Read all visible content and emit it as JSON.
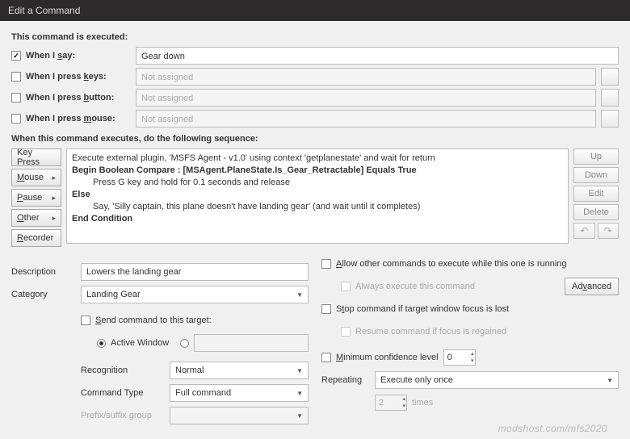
{
  "window": {
    "title": "Edit a Command"
  },
  "section1_head": "This command is executed:",
  "triggers": {
    "say_label": "When I say:",
    "say_value": "Gear down",
    "keys_label": "When I press keys:",
    "keys_value": "Not assigned",
    "button_label": "When I press button:",
    "button_value": "Not assigned",
    "mouse_label": "When I press mouse:",
    "mouse_value": "Not assigned"
  },
  "section2_head": "When this command executes, do the following sequence:",
  "side_buttons": {
    "keypress": "Key Press",
    "mouse": "Mouse",
    "pause": "Pause",
    "other": "Other",
    "recorder": "Recorder"
  },
  "script": {
    "l1": "Execute external plugin, 'MSFS Agent - v1.0' using context 'getplanestate' and wait for return",
    "l2": "Begin Boolean Compare : [MSAgent.PlaneState.Is_Gear_Retractable] Equals True",
    "l3": "Press G key and hold for 0.1 seconds and release",
    "l4": "Else",
    "l5": "Say, 'Silly captain, this plane doesn't have landing gear'  (and wait until it completes)",
    "l6": "End Condition"
  },
  "right_buttons": {
    "up": "Up",
    "down": "Down",
    "edit": "Edit",
    "delete": "Delete"
  },
  "fields": {
    "description_label": "Description",
    "description_value": "Lowers the landing gear",
    "category_label": "Category",
    "category_value": "Landing Gear",
    "send_target_label": "Send command to this target:",
    "active_window": "Active Window",
    "recognition_label": "Recognition",
    "recognition_value": "Normal",
    "cmdtype_label": "Command Type",
    "cmdtype_value": "Full command",
    "prefix_label": "Prefix/suffix group"
  },
  "options": {
    "allow_other": "Allow other commands to execute while this one is running",
    "always_exec": "Always execute this command",
    "advanced": "Advanced",
    "stop_focus": "Stop command if target window focus is lost",
    "resume_focus": "Resume command if focus is regained",
    "min_conf": "Minimum confidence level",
    "min_conf_val": "0",
    "repeating_label": "Repeating",
    "repeating_value": "Execute only once",
    "times_val": "2",
    "times_label": "times"
  },
  "watermark": "modshost.com/mfs2020"
}
